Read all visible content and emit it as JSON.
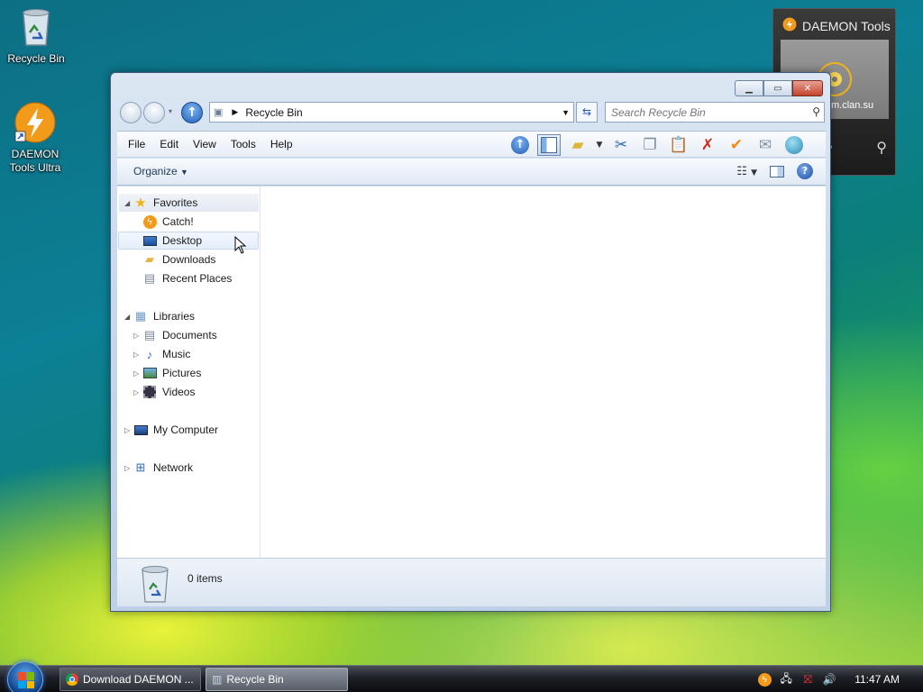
{
  "desktop": {
    "icons": [
      {
        "label": "Recycle Bin"
      },
      {
        "label": "DAEMON Tools Ultra"
      }
    ]
  },
  "gadget": {
    "title": "DAEMON Tools",
    "screen_text": "m.clan.su"
  },
  "window": {
    "address": {
      "location": "Recycle Bin"
    },
    "search": {
      "placeholder": "Search Recycle Bin"
    },
    "menu": [
      "File",
      "Edit",
      "View",
      "Tools",
      "Help"
    ],
    "command_bar": {
      "organize": "Organize"
    },
    "nav_tree": {
      "favorites": {
        "label": "Favorites",
        "items": [
          "Catch!",
          "Desktop",
          "Downloads",
          "Recent Places"
        ]
      },
      "libraries": {
        "label": "Libraries",
        "items": [
          "Documents",
          "Music",
          "Pictures",
          "Videos"
        ]
      },
      "computer": {
        "label": "My Computer"
      },
      "network": {
        "label": "Network"
      }
    },
    "details": {
      "count": "0 items"
    }
  },
  "taskbar": {
    "tasks": [
      {
        "label": "Download DAEMON ..."
      },
      {
        "label": "Recycle Bin"
      }
    ],
    "clock": "11:47 AM"
  },
  "colors": {
    "accent": "#1f5fb8",
    "close_button": "#c4442d",
    "selection": "#e3eefa"
  }
}
